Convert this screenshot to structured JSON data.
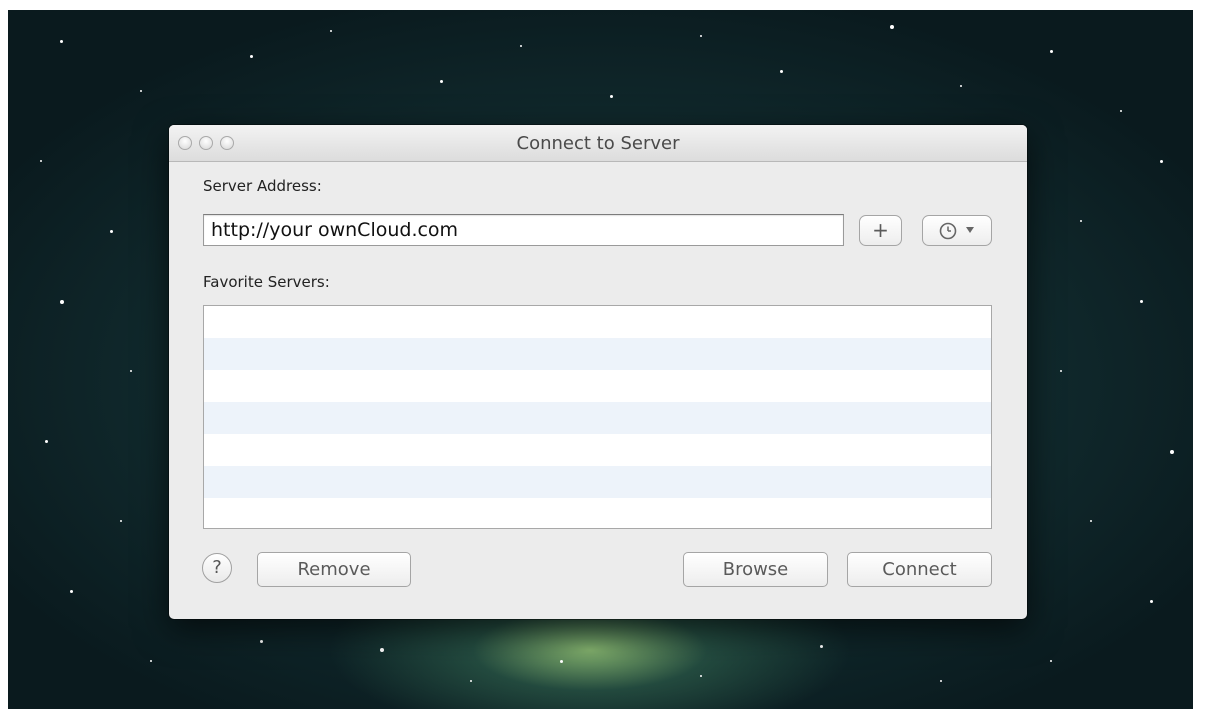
{
  "window": {
    "title": "Connect to Server"
  },
  "server_address": {
    "label": "Server Address:",
    "value": "http://your ownCloud.com"
  },
  "toolbar": {
    "add_label": "+",
    "recent_icon": "clock-icon",
    "dropdown_icon": "chevron-down-icon"
  },
  "favorites": {
    "label": "Favorite Servers:",
    "rows": [
      "",
      "",
      "",
      "",
      "",
      "",
      ""
    ]
  },
  "buttons": {
    "help": "?",
    "remove": "Remove",
    "browse": "Browse",
    "connect": "Connect"
  },
  "colors": {
    "window_bg": "#ececec",
    "list_alt_row": "#edf3fa"
  }
}
